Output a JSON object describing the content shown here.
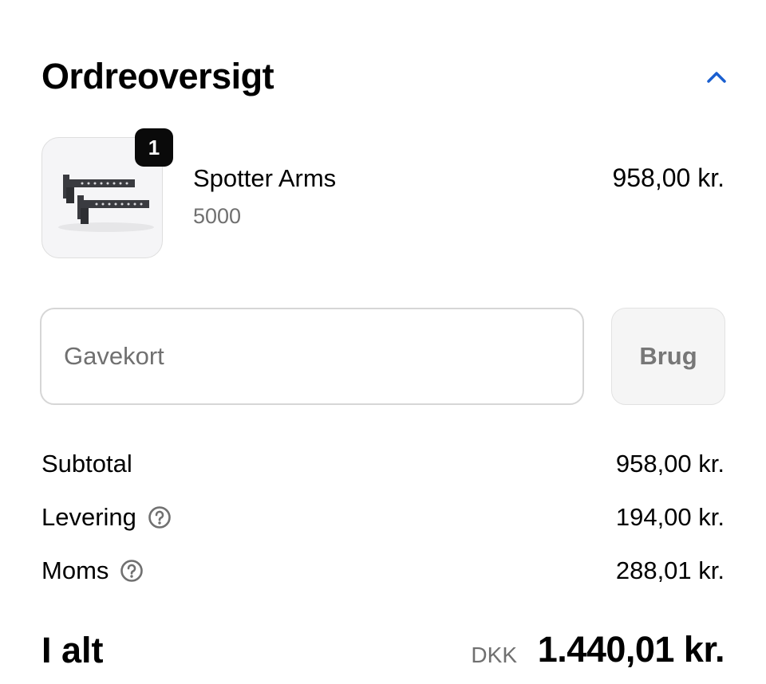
{
  "summary": {
    "title": "Ordreoversigt"
  },
  "product": {
    "quantity": "1",
    "name": "Spotter Arms",
    "variant": "5000",
    "price": "958,00 kr."
  },
  "gift_card": {
    "placeholder": "Gavekort",
    "apply_label": "Brug"
  },
  "lines": {
    "subtotal_label": "Subtotal",
    "subtotal_value": "958,00 kr.",
    "shipping_label": "Levering",
    "shipping_value": "194,00 kr.",
    "tax_label": "Moms",
    "tax_value": "288,01 kr."
  },
  "total": {
    "label": "I alt",
    "currency": "DKK",
    "value": "1.440,01 kr."
  },
  "colors": {
    "accent": "#1a5fd0",
    "muted_text": "#707070"
  }
}
